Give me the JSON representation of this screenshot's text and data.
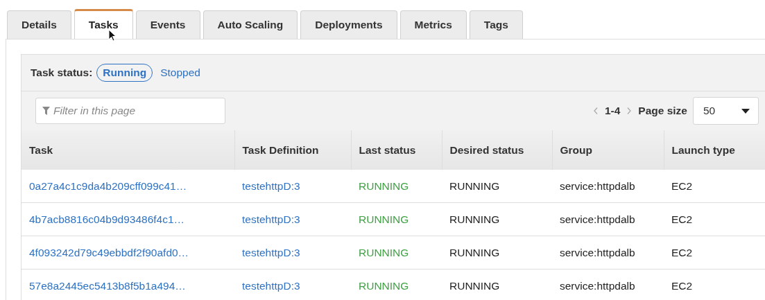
{
  "tabs": [
    {
      "label": "Details",
      "selected": false
    },
    {
      "label": "Tasks",
      "selected": true
    },
    {
      "label": "Events",
      "selected": false
    },
    {
      "label": "Auto Scaling",
      "selected": false
    },
    {
      "label": "Deployments",
      "selected": false
    },
    {
      "label": "Metrics",
      "selected": false
    },
    {
      "label": "Tags",
      "selected": false
    }
  ],
  "task_status": {
    "label": "Task status:",
    "options": [
      {
        "label": "Running",
        "selected": true
      },
      {
        "label": "Stopped",
        "selected": false
      }
    ]
  },
  "filter": {
    "placeholder": "Filter in this page"
  },
  "pagination": {
    "range": "1-4",
    "page_size_label": "Page size",
    "page_size": "50"
  },
  "table": {
    "columns": [
      "Task",
      "Task Definition",
      "Last status",
      "Desired status",
      "Group",
      "Launch type"
    ],
    "rows": [
      {
        "task": "0a27a4c1c9da4b209cff099c41…",
        "task_definition": "testehttpD:3",
        "last_status": "RUNNING",
        "desired_status": "RUNNING",
        "group": "service:httpdalb",
        "launch_type": "EC2"
      },
      {
        "task": "4b7acb8816c04b9d93486f4c1…",
        "task_definition": "testehttpD:3",
        "last_status": "RUNNING",
        "desired_status": "RUNNING",
        "group": "service:httpdalb",
        "launch_type": "EC2"
      },
      {
        "task": "4f093242d79c49ebbdf2f90afd0…",
        "task_definition": "testehttpD:3",
        "last_status": "RUNNING",
        "desired_status": "RUNNING",
        "group": "service:httpdalb",
        "launch_type": "EC2"
      },
      {
        "task": "57e8a2445ec5413b8f5b1a494…",
        "task_definition": "testehttpD:3",
        "last_status": "RUNNING",
        "desired_status": "RUNNING",
        "group": "service:httpdalb",
        "launch_type": "EC2"
      }
    ]
  }
}
